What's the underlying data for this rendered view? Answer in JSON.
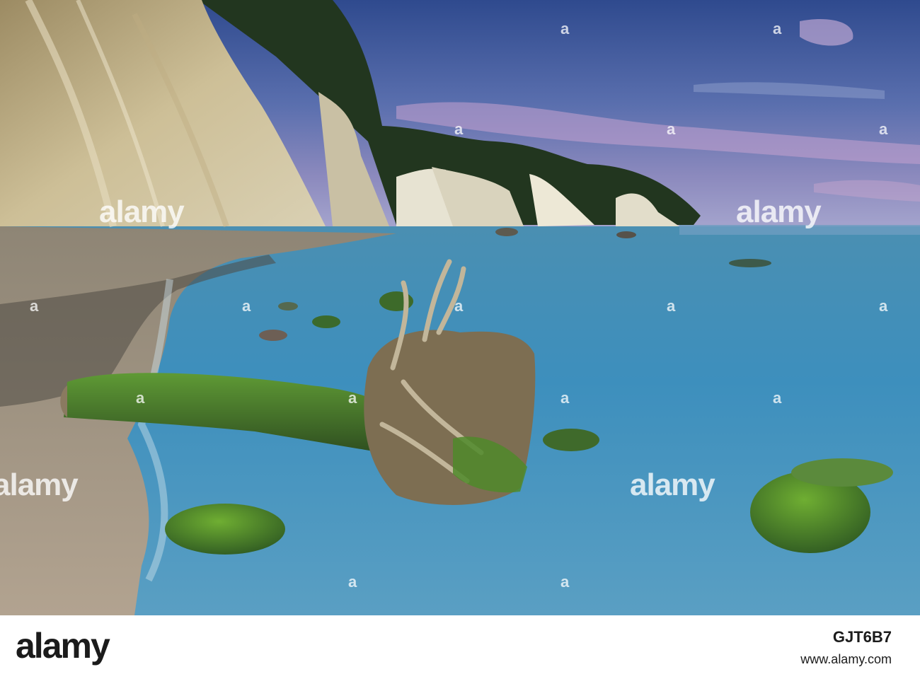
{
  "watermark": {
    "text": "alamy",
    "dot": "a"
  },
  "footer": {
    "logo": "alamy",
    "image_id": "GJT6B7",
    "url": "www.alamy.com"
  },
  "colors": {
    "sky_top": "#3a4f8c",
    "sky_pink": "#c99ac9",
    "sea": "#3f8fb8",
    "cliff": "#c9b991",
    "forest": "#23361f",
    "moss": "#4b8a2a",
    "sand": "#a89a85"
  }
}
